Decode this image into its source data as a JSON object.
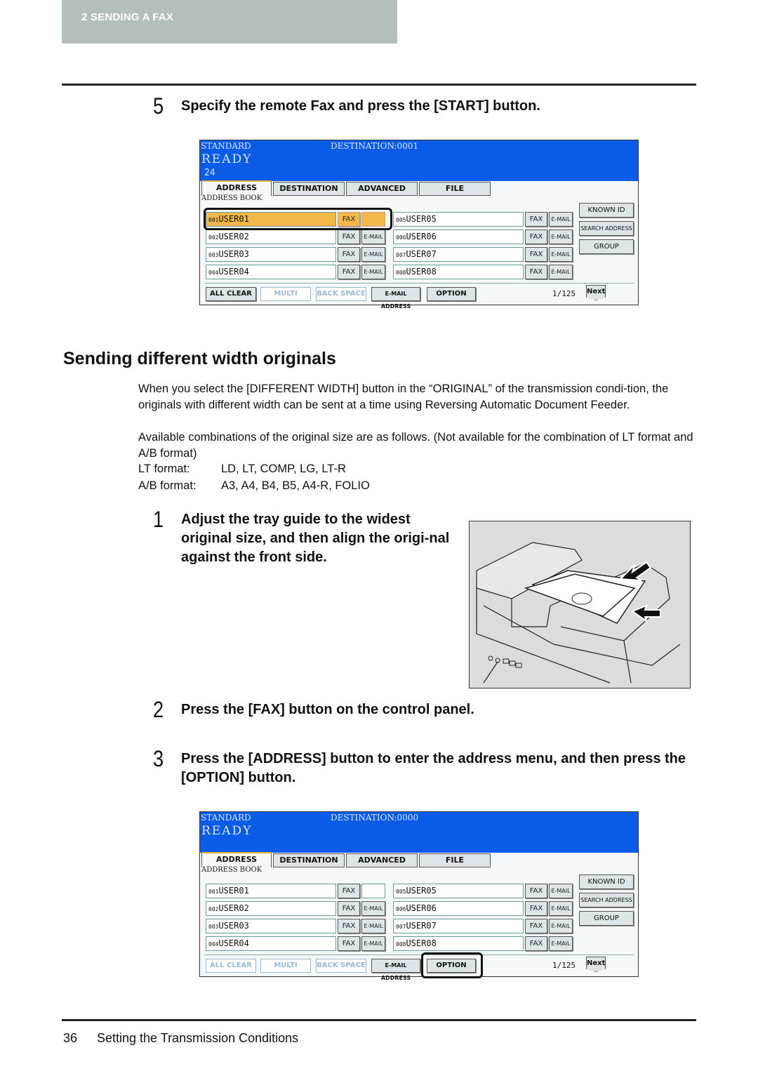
{
  "header": {
    "chapter_label": "2   SENDING A FAX"
  },
  "step5": {
    "num": "5",
    "text": "Specify the remote Fax and press the [START] button."
  },
  "panel1": {
    "mode": "STANDARD",
    "destination": "DESTINATION:0001",
    "status": "READY",
    "count": "24",
    "tabs": [
      "ADDRESS",
      "DESTINATION",
      "ADVANCED",
      "FILE"
    ],
    "section": "ADDRESS BOOK",
    "entries": [
      {
        "no": "001",
        "name": "USER01",
        "fax": "FAX",
        "email": ""
      },
      {
        "no": "002",
        "name": "USER02",
        "fax": "FAX",
        "email": "E-MAIL"
      },
      {
        "no": "003",
        "name": "USER03",
        "fax": "FAX",
        "email": "E-MAIL"
      },
      {
        "no": "004",
        "name": "USER04",
        "fax": "FAX",
        "email": "E-MAIL"
      },
      {
        "no": "005",
        "name": "USER05",
        "fax": "FAX",
        "email": "E-MAIL"
      },
      {
        "no": "006",
        "name": "USER06",
        "fax": "FAX",
        "email": "E-MAIL"
      },
      {
        "no": "007",
        "name": "USER07",
        "fax": "FAX",
        "email": "E-MAIL"
      },
      {
        "no": "008",
        "name": "USER08",
        "fax": "FAX",
        "email": "E-MAIL"
      }
    ],
    "side_buttons": [
      "KNOWN ID",
      "SEARCH ADDRESS",
      "GROUP"
    ],
    "bottom_buttons": [
      "ALL CLEAR",
      "MULTI",
      "BACK SPACE",
      "E-MAIL ADDRESS",
      "OPTION"
    ],
    "page": "1/125",
    "next": "Next"
  },
  "section": {
    "title": "Sending different width originals",
    "para1": "When you select the [DIFFERENT WIDTH] button in the “ORIGINAL” of the transmission condi-tion, the originals with different width can be sent at a time using Reversing Automatic Document Feeder.",
    "para2": "Available combinations of the original size are as follows. (Not available for the combination of LT format and A/B format)",
    "formats": [
      {
        "label": "LT format:",
        "value": "LD, LT, COMP, LG, LT-R"
      },
      {
        "label": "A/B format:",
        "value": "A3, A4, B4, B5, A4-R, FOLIO"
      }
    ]
  },
  "step1": {
    "num": "1",
    "text": "Adjust the tray guide to the widest original size, and then align the origi-nal against the front side."
  },
  "step2": {
    "num": "2",
    "text": "Press the [FAX] button on the control panel."
  },
  "step3": {
    "num": "3",
    "text": "Press the [ADDRESS] button to enter the address menu, and then press the [OPTION] button."
  },
  "panel2": {
    "mode": "STANDARD",
    "destination": "DESTINATION:0000",
    "status": "READY",
    "count": "",
    "tabs": [
      "ADDRESS",
      "DESTINATION",
      "ADVANCED",
      "FILE"
    ],
    "section": "ADDRESS BOOK",
    "entries": [
      {
        "no": "001",
        "name": "USER01",
        "fax": "FAX",
        "email": ""
      },
      {
        "no": "002",
        "name": "USER02",
        "fax": "FAX",
        "email": "E-MAIL"
      },
      {
        "no": "003",
        "name": "USER03",
        "fax": "FAX",
        "email": "E-MAIL"
      },
      {
        "no": "004",
        "name": "USER04",
        "fax": "FAX",
        "email": "E-MAIL"
      },
      {
        "no": "005",
        "name": "USER05",
        "fax": "FAX",
        "email": "E-MAIL"
      },
      {
        "no": "006",
        "name": "USER06",
        "fax": "FAX",
        "email": "E-MAIL"
      },
      {
        "no": "007",
        "name": "USER07",
        "fax": "FAX",
        "email": "E-MAIL"
      },
      {
        "no": "008",
        "name": "USER08",
        "fax": "FAX",
        "email": "E-MAIL"
      }
    ],
    "side_buttons": [
      "KNOWN ID",
      "SEARCH ADDRESS",
      "GROUP"
    ],
    "bottom_buttons": [
      "ALL CLEAR",
      "MULTI",
      "BACK SPACE",
      "E-MAIL ADDRESS",
      "OPTION"
    ],
    "page": "1/125",
    "next": "Next"
  },
  "footer": {
    "page_number": "36",
    "title": "Setting the Transmission Conditions"
  }
}
